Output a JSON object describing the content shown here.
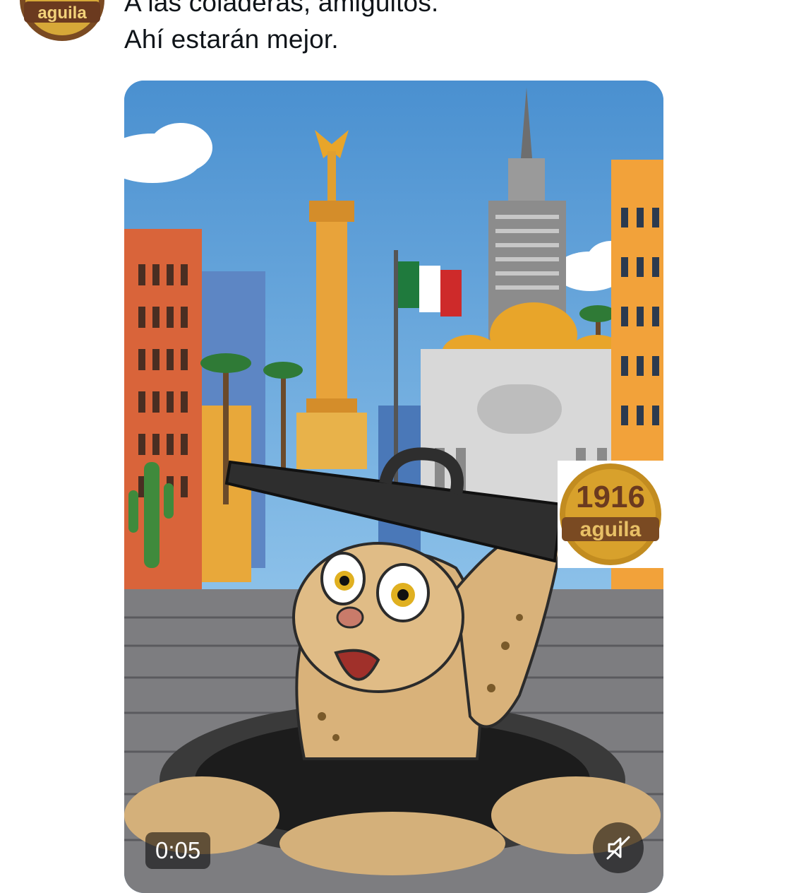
{
  "author": {
    "avatar_text": "aguila",
    "avatar_icon": "aguila-logo-icon"
  },
  "tweet": {
    "lines": [
      "A las coladeras, amiguitos.",
      "Ahí estarán mejor."
    ]
  },
  "media": {
    "type": "video",
    "timestamp": "0:05",
    "mute_icon": "speaker-muted-icon",
    "badge": {
      "year": "1916",
      "brand": "aguila"
    }
  },
  "colors": {
    "brand_gold": "#c9a030",
    "brand_brown": "#6b3a1f",
    "sky": "#5b9bd5"
  }
}
